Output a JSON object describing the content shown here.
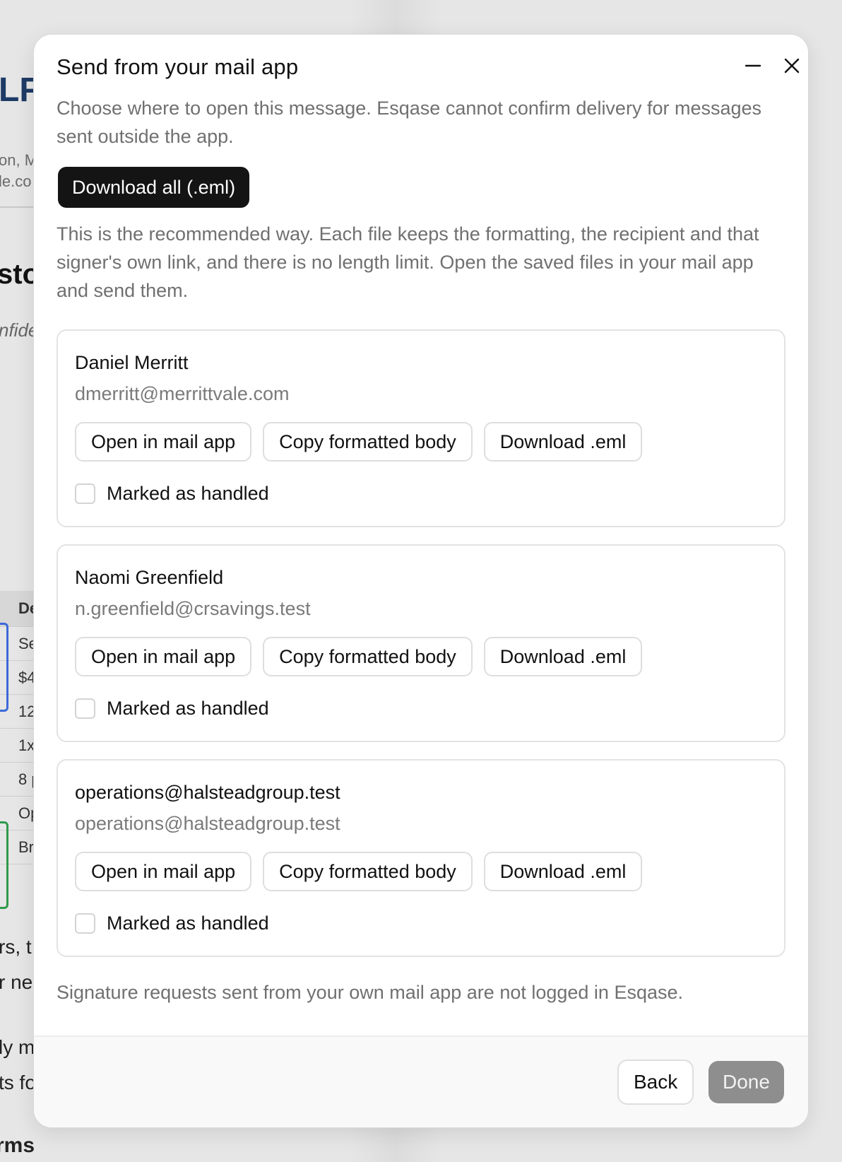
{
  "background": {
    "logo_fragment": "LF",
    "sub_line_1": "on, M",
    "sub_line_2": "le.co",
    "heading_fragment": "stoc",
    "italic_fragment": "nfide",
    "table_rows": [
      "De",
      "Se",
      "$4",
      "12",
      "1x",
      "8 p",
      "Op",
      "Br"
    ],
    "para_1": "rs, t",
    "para_2": "r ne",
    "para_3": "ly m",
    "para_4": "ts fo",
    "para_5": "rms"
  },
  "dialog": {
    "title": "Send from your mail app",
    "minimize_icon": "minus-icon",
    "close_icon": "close-icon",
    "description": "Choose where to open this message. Esqase cannot confirm delivery for messages sent outside the app.",
    "download_all_label": "Download all (.eml)",
    "recommendation": "This is the recommended way. Each file keeps the formatting, the recipient and that signer's own link, and there is no length limit. Open the saved files in your mail app and send them.",
    "recipients": [
      {
        "name": "Daniel Merritt",
        "email": "dmerritt@merrittvale.com",
        "open_label": "Open in mail app",
        "copy_label": "Copy formatted body",
        "download_label": "Download .eml",
        "handled_label": "Marked as handled",
        "handled": false
      },
      {
        "name": "Naomi Greenfield",
        "email": "n.greenfield@crsavings.test",
        "open_label": "Open in mail app",
        "copy_label": "Copy formatted body",
        "download_label": "Download .eml",
        "handled_label": "Marked as handled",
        "handled": false
      },
      {
        "name": "operations@halsteadgroup.test",
        "email": "operations@halsteadgroup.test",
        "open_label": "Open in mail app",
        "copy_label": "Copy formatted body",
        "download_label": "Download .eml",
        "handled_label": "Marked as handled",
        "handled": false
      }
    ],
    "footnote": "Signature requests sent from your own mail app are not logged in Esqase.",
    "back_label": "Back",
    "done_label": "Done",
    "done_disabled": true
  },
  "colors": {
    "primary_button": "#141414",
    "disabled_button": "#8e8e8e",
    "muted_text": "#707070"
  }
}
